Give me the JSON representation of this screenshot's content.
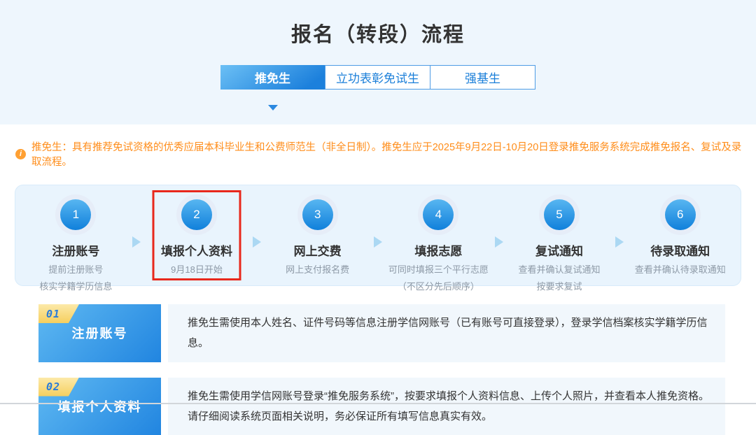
{
  "page": {
    "title": "报名（转段）流程"
  },
  "tabs": [
    {
      "label": "推免生",
      "active": true
    },
    {
      "label": "立功表彰免试生",
      "active": false
    },
    {
      "label": "强基生",
      "active": false
    }
  ],
  "notice": {
    "icon": "info-icon",
    "icon_glyph": "i",
    "text": "推免生：具有推荐免试资格的优秀应届本科毕业生和公费师范生（非全日制）。推免生应于2025年9月22日-10月20日登录推免服务系统完成推免报名、复试及录取流程。"
  },
  "steps": [
    {
      "num": "1",
      "title": "注册账号",
      "lines": [
        "提前注册账号",
        "核实学籍学历信息"
      ],
      "highlighted": false
    },
    {
      "num": "2",
      "title": "填报个人资料",
      "lines": [
        "9月18日开始"
      ],
      "highlighted": true
    },
    {
      "num": "3",
      "title": "网上交费",
      "lines": [
        "网上支付报名费"
      ],
      "highlighted": false
    },
    {
      "num": "4",
      "title": "填报志愿",
      "lines": [
        "可同时填报三个平行志愿",
        "（不区分先后顺序）"
      ],
      "highlighted": false
    },
    {
      "num": "5",
      "title": "复试通知",
      "lines": [
        "查看并确认复试通知",
        "按要求复试"
      ],
      "highlighted": false
    },
    {
      "num": "6",
      "title": "待录取通知",
      "lines": [
        "查看并确认待录取通知"
      ],
      "highlighted": false
    }
  ],
  "sections": [
    {
      "num": "01",
      "label": "注册账号",
      "desc": "推免生需使用本人姓名、证件号码等信息注册学信网账号（已有账号可直接登录），登录学信档案核实学籍学历信息。"
    },
    {
      "num": "02",
      "label": "填报个人资料",
      "desc": "推免生需使用学信网账号登录“推免服务系统”，按要求填报个人资料信息、上传个人照片，并查看本人推免资格。请仔细阅读系统页面相关说明，务必保证所有填写信息真实有效。"
    }
  ],
  "colors": {
    "accent_blue": "#1f85de",
    "hero_band": "#eef6fd",
    "steps_panel": "#e9f4fd",
    "notice_orange": "#ff8d1a",
    "highlight_red": "#e8281c",
    "badge_yellow": "#f6cf5e",
    "desc_bg": "#f1f7fc"
  }
}
